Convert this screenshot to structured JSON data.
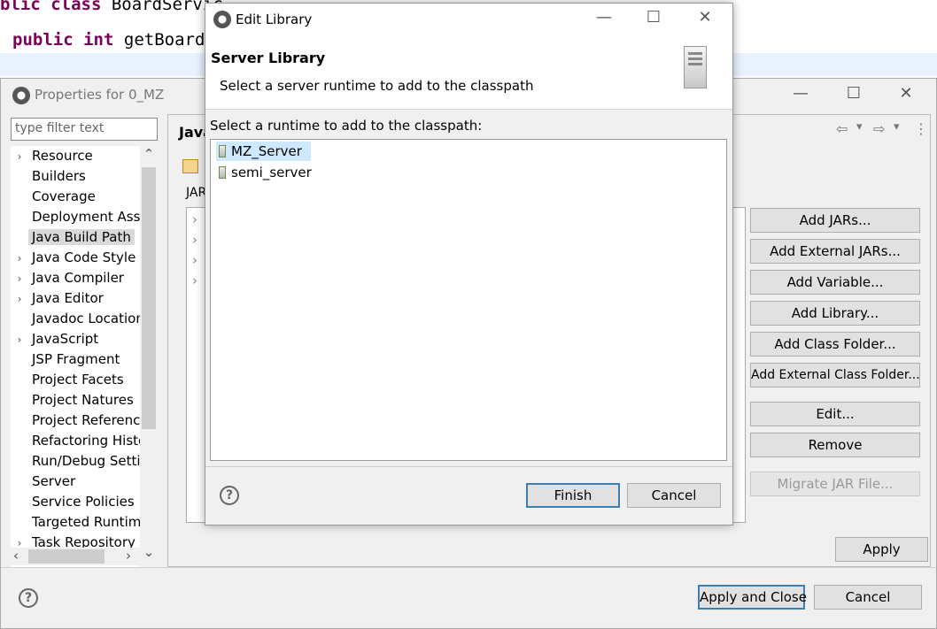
{
  "editor": {
    "line1_prefix": "blic class ",
    "line1_rest": "BoardServic",
    "line2_kw1": "public",
    "line2_kw2": "int",
    "line2_rest": "getBoardC"
  },
  "properties_window": {
    "title": "Properties for 0_MZ",
    "filter_placeholder": "type filter text",
    "tree_items": [
      {
        "label": "Resource",
        "arrow": true
      },
      {
        "label": "Builders",
        "arrow": false
      },
      {
        "label": "Coverage",
        "arrow": false
      },
      {
        "label": "Deployment Assembly",
        "arrow": false
      },
      {
        "label": "Java Build Path",
        "arrow": false
      },
      {
        "label": "Java Code Style",
        "arrow": true
      },
      {
        "label": "Java Compiler",
        "arrow": true
      },
      {
        "label": "Java Editor",
        "arrow": true
      },
      {
        "label": "Javadoc Location",
        "arrow": false
      },
      {
        "label": "JavaScript",
        "arrow": true
      },
      {
        "label": "JSP Fragment",
        "arrow": false
      },
      {
        "label": "Project Facets",
        "arrow": false
      },
      {
        "label": "Project Natures",
        "arrow": false
      },
      {
        "label": "Project References",
        "arrow": false
      },
      {
        "label": "Refactoring History",
        "arrow": false
      },
      {
        "label": "Run/Debug Settings",
        "arrow": false
      },
      {
        "label": "Server",
        "arrow": false
      },
      {
        "label": "Service Policies",
        "arrow": false
      },
      {
        "label": "Targeted Runtimes",
        "arrow": false
      },
      {
        "label": "Task Repository",
        "arrow": true
      }
    ],
    "selected_tree_item": "Java Build Path",
    "panel_title": "Java",
    "panel_tab_label": "JAR",
    "side_buttons": {
      "add_jars": "Add JARs...",
      "add_external_jars": "Add External JARs...",
      "add_variable": "Add Variable...",
      "add_library": "Add Library...",
      "add_class_folder": "Add Class Folder...",
      "add_external_class_folder": "Add External Class Folder...",
      "edit": "Edit...",
      "remove": "Remove",
      "migrate_jar": "Migrate JAR File..."
    },
    "apply": "Apply",
    "apply_and_close": "Apply and Close",
    "cancel": "Cancel"
  },
  "dialog": {
    "title": "Edit Library",
    "header_title": "Server Library",
    "header_subtitle": "Select a server runtime to add to the classpath",
    "list_label": "Select a runtime to add to the classpath:",
    "runtimes": [
      "MZ_Server",
      "semi_server"
    ],
    "selected_runtime": "MZ_Server",
    "finish": "Finish",
    "cancel": "Cancel"
  },
  "glyphs": {
    "minimize": "—",
    "maximize": "☐",
    "close": "✕",
    "help": "?",
    "scroll_up": "⌃",
    "scroll_down": "⌄",
    "scroll_left": "‹",
    "scroll_right": "›",
    "nav_back": "⇦",
    "nav_forward": "⇨",
    "dropdown": "▾",
    "more": "⋮",
    "expander": "›"
  }
}
